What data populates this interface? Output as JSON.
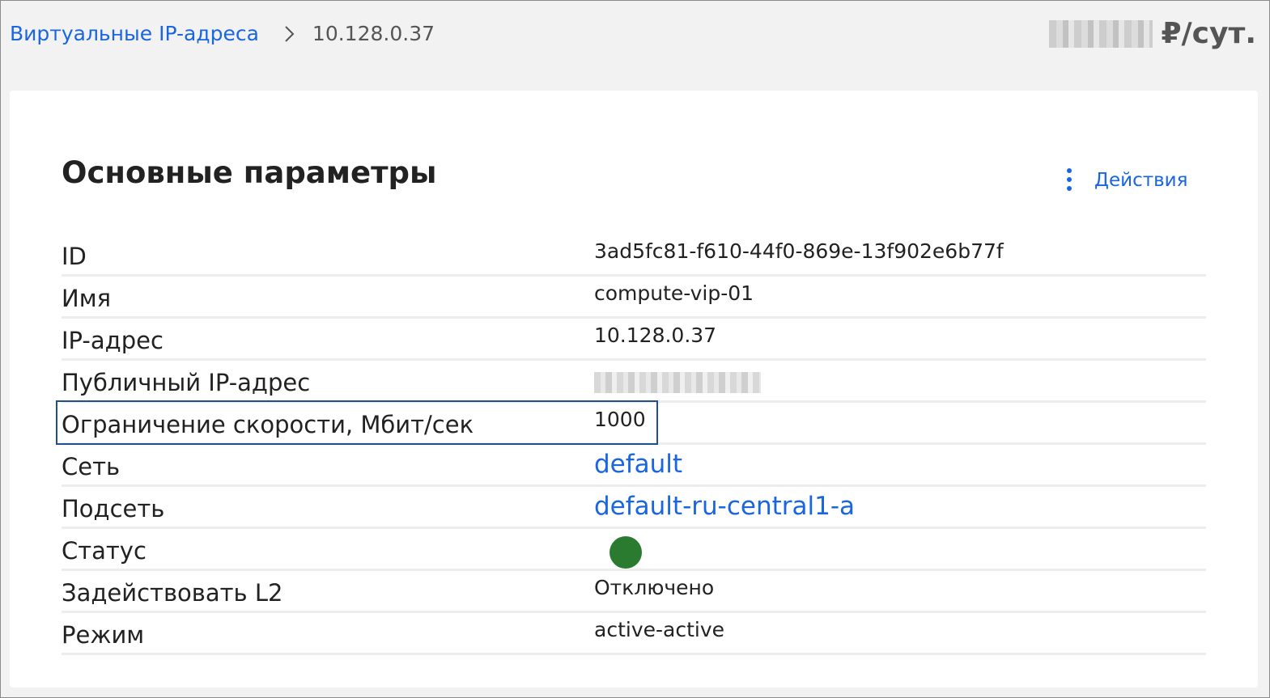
{
  "breadcrumb": {
    "parent": "Виртуальные IP-адреса",
    "current": "10.128.0.37"
  },
  "price": {
    "unit": "₽/сут."
  },
  "section": {
    "title": "Основные параметры",
    "actions_label": "Действия"
  },
  "params": {
    "id": {
      "label": "ID",
      "value": "3ad5fc81-f610-44f0-869e-13f902e6b77f"
    },
    "name": {
      "label": "Имя",
      "value": "compute-vip-01"
    },
    "ip": {
      "label": "IP-адрес",
      "value": "10.128.0.37"
    },
    "public_ip": {
      "label": "Публичный IP-адрес"
    },
    "speed": {
      "label": "Ограничение скорости, Мбит/сек",
      "value": "1000"
    },
    "network": {
      "label": "Сеть",
      "value": "default"
    },
    "subnet": {
      "label": "Подсеть",
      "value": "default-ru-central1-a"
    },
    "status": {
      "label": "Статус",
      "color": "#2a7a30"
    },
    "l2": {
      "label": "Задействовать L2",
      "value": "Отключено"
    },
    "mode": {
      "label": "Режим",
      "value": "active-active"
    }
  },
  "colors": {
    "link": "#1a66e0",
    "focus": "#1d4f91"
  }
}
